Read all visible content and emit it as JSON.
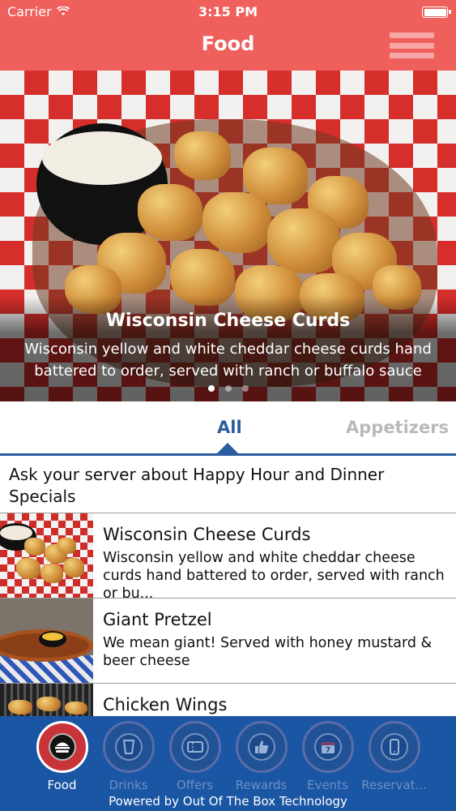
{
  "status_bar": {
    "carrier": "Carrier",
    "time": "3:15 PM"
  },
  "nav": {
    "title": "Food"
  },
  "hero": {
    "title": "Wisconsin Cheese Curds",
    "description": "Wisconsin yellow and white cheddar cheese curds hand battered to order, served with ranch or buffalo sauce",
    "pages": 3,
    "active_page": 1
  },
  "tabs": [
    {
      "label": "All",
      "selected": true
    },
    {
      "label": "Appetizers",
      "selected": false
    }
  ],
  "notice": "Ask your server about Happy Hour and Dinner Specials",
  "menu_items": [
    {
      "title": "Wisconsin Cheese Curds",
      "description": "Wisconsin yellow and white cheddar cheese curds hand battered to order, served with ranch or bu..."
    },
    {
      "title": "Giant Pretzel",
      "description": "We mean giant! Served with honey mustard & beer cheese"
    },
    {
      "title": "Chicken Wings",
      "description": ""
    }
  ],
  "tab_bar": {
    "items": [
      {
        "label": "Food",
        "icon": "burger-icon",
        "active": true
      },
      {
        "label": "Drinks",
        "icon": "glass-icon",
        "active": false
      },
      {
        "label": "Offers",
        "icon": "ticket-icon",
        "active": false
      },
      {
        "label": "Rewards",
        "icon": "thumbs-up-icon",
        "active": false
      },
      {
        "label": "Events",
        "icon": "calendar-icon",
        "active": false
      },
      {
        "label": "Reservat...",
        "icon": "phone-icon",
        "active": false
      }
    ],
    "powered_by": "Powered by Out Of The Box Technology"
  },
  "colors": {
    "header": "#ef5f5b",
    "accent_blue": "#2a5d9f",
    "tab_bar": "#1a56a4",
    "inactive_tab": "#b9b9b9"
  }
}
